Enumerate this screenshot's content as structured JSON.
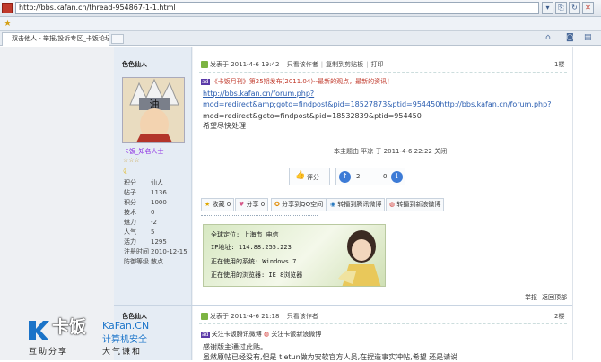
{
  "browser": {
    "url": "http://bbs.kafan.cn/thread-954867-1-1.html",
    "tab_title": "双击他人 - 举报/投诉专区_卡饭论坛..."
  },
  "post1": {
    "author": "色色仙人",
    "rank": "卡饭_知名人士",
    "stars": "☆☆☆",
    "stats": [
      {
        "label": "积分",
        "value": "仙人"
      },
      {
        "label": "帖子",
        "value": "1136"
      },
      {
        "label": "积分",
        "value": "1000"
      },
      {
        "label": "技术",
        "value": "0"
      },
      {
        "label": "魅力",
        "value": "-2"
      },
      {
        "label": "人气",
        "value": "5"
      },
      {
        "label": "活力",
        "value": "1295"
      },
      {
        "label": "注册时间",
        "value": "2010-12-15"
      },
      {
        "label": "防御等级",
        "value": "散点"
      }
    ],
    "meta": {
      "posted": "发表于 2011-4-6 19:42",
      "only_author": "只看该作者",
      "copy_link": "复制到剪贴板",
      "print": "打印",
      "floor": "1楼"
    },
    "promo_text": "《卡饭月刊》第25期发布(2011.04)--最新的观点，最新的资讯！",
    "link1": "http://bbs.kafan.cn/forum.php?",
    "link2": "mod=redirect&amp;goto=findpost&pid=18527873&ptid=954450http://bbs.kafan.cn/forum.php?",
    "text1": "mod=redirect&goto=findpost&pid=18532839&ptid=954450",
    "text2": "希望尽快处理",
    "closed_note": "本主题由 平凉 于 2011-4-6 22:22 关闭",
    "rate_label": "评分",
    "vote_up": "2",
    "vote_down": "0",
    "share_buttons": [
      "收藏 0",
      "分享 0",
      "分享到QQ空间",
      "转播到腾讯微博",
      "转播到新浪微博"
    ],
    "sig_lines": [
      "全球定位: 上海市 电信",
      "IP地址: 114.88.255.223",
      "正在使用的系统: Windows 7",
      "正在使用的浏览器: IE 8浏览器"
    ],
    "report": "举报",
    "back_top": "返回顶部"
  },
  "post2": {
    "author": "色色仙人",
    "meta": {
      "posted": "发表于 2011-4-6 21:18",
      "only_author": "只看该作者",
      "floor": "2楼"
    },
    "share1": "关注卡饭腾讯微博",
    "share2": "关注卡饭新浪微博",
    "text1": "感谢版主通过此贴。",
    "text2": "虽然原帖已经没有,但是 tietun做为安软官方人员,在捏造事实冲帖,希望 还是请说"
  },
  "watermark": {
    "brand": "卡饭",
    "site": "KaFan.CN",
    "slogan1": "计算机安全",
    "slogan2": "互助分享",
    "slogan3": "大气谦和"
  },
  "colors": {
    "accent_link": "#2a5db0",
    "promo_red": "#c0392b",
    "rank_purple": "#8a2be2"
  }
}
